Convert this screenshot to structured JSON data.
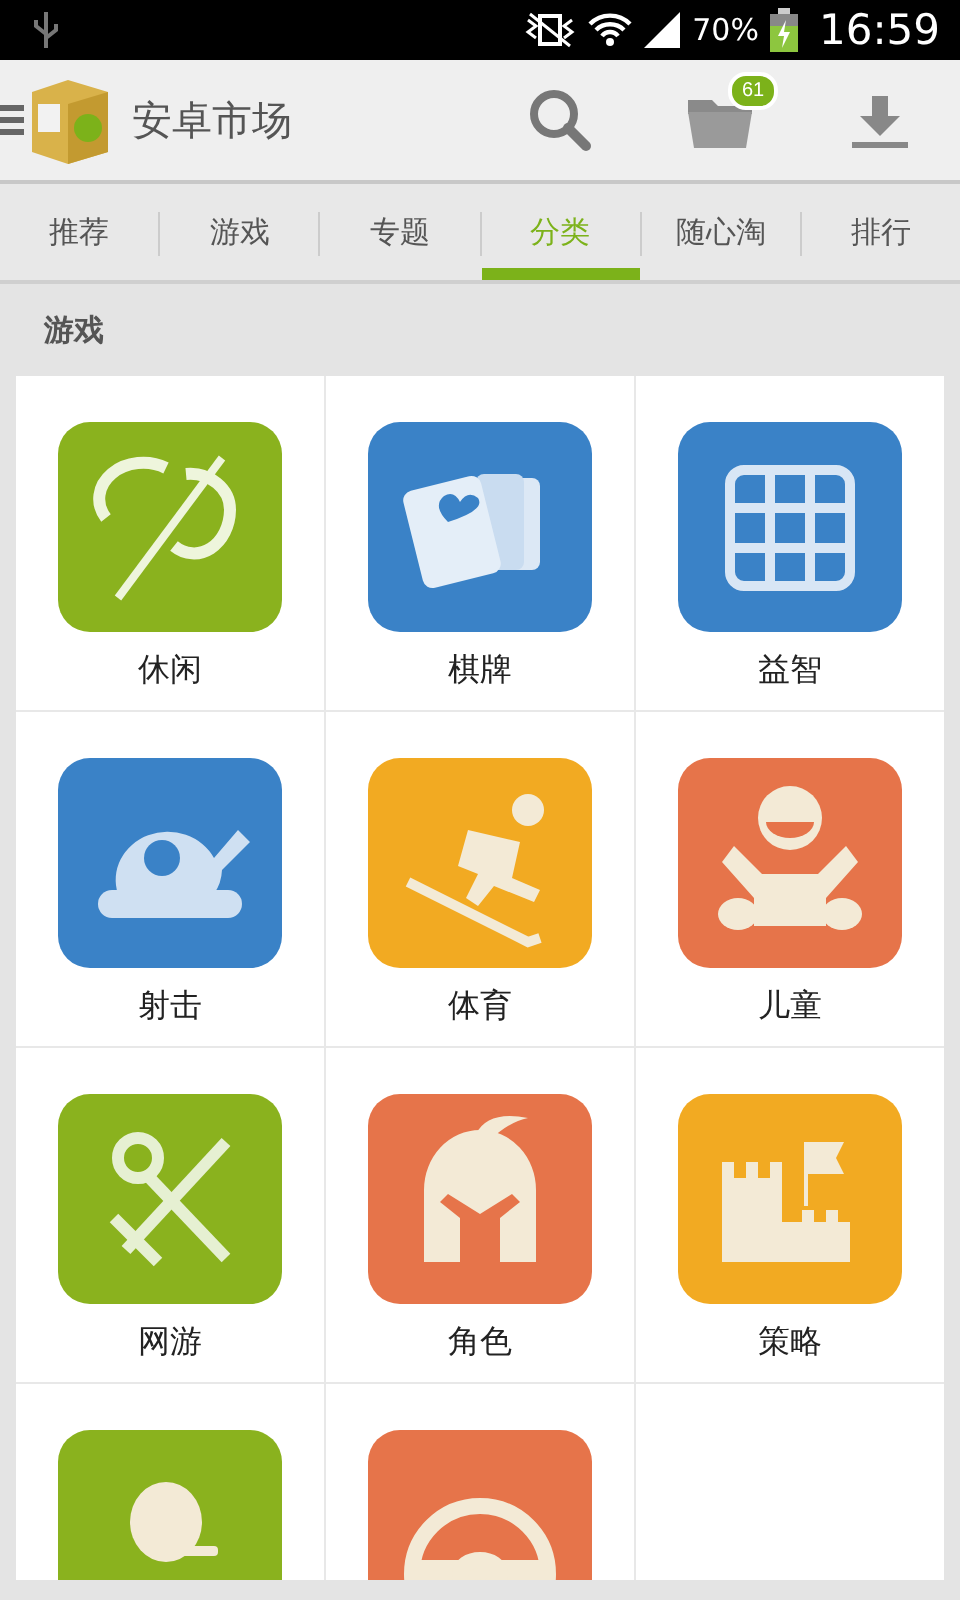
{
  "status_bar": {
    "battery": "70%",
    "time": "16:59"
  },
  "app_bar": {
    "title": "安卓市场",
    "badge": "61"
  },
  "tabs": [
    {
      "label": "推荐",
      "selected": false
    },
    {
      "label": "游戏",
      "selected": false
    },
    {
      "label": "专题",
      "selected": false
    },
    {
      "label": "分类",
      "selected": true
    },
    {
      "label": "随心淘",
      "selected": false
    },
    {
      "label": "排行",
      "selected": false
    }
  ],
  "section": {
    "title": "游戏"
  },
  "categories": [
    {
      "label": "休闲",
      "kind": "leaf",
      "color": "#8ab21e"
    },
    {
      "label": "棋牌",
      "kind": "cards",
      "color": "#3a82c7"
    },
    {
      "label": "益智",
      "kind": "puzzle",
      "color": "#3a82c7"
    },
    {
      "label": "射击",
      "kind": "tank",
      "color": "#3a82c7"
    },
    {
      "label": "体育",
      "kind": "skier",
      "color": "#f2aa22"
    },
    {
      "label": "儿童",
      "kind": "baby",
      "color": "#e6744a"
    },
    {
      "label": "网游",
      "kind": "swords",
      "color": "#8ab21e"
    },
    {
      "label": "角色",
      "kind": "helmet",
      "color": "#e6744a"
    },
    {
      "label": "策略",
      "kind": "castle",
      "color": "#f2aa22"
    },
    {
      "kind": "person",
      "color": "#8ab21e"
    },
    {
      "kind": "wheel",
      "color": "#e6744a"
    }
  ]
}
